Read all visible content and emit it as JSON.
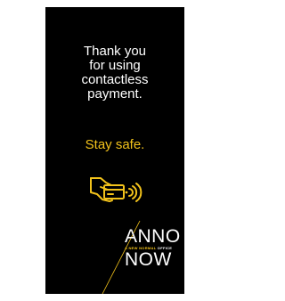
{
  "message": {
    "lines": [
      "Thank you",
      "for using",
      "contactless",
      "payment."
    ]
  },
  "subtext": "Stay safe.",
  "logo": {
    "line1": "ANNO",
    "tag_prefix": "A ",
    "tag_highlight": "NEW NORMAL",
    "tag_suffix": " OFFICE",
    "line2": "NOW"
  },
  "icons": {
    "payment": "contactless-card-payment-icon"
  },
  "colors": {
    "background": "#000000",
    "text": "#ffffff",
    "accent": "#f2c21b",
    "page": "#ffffff"
  }
}
